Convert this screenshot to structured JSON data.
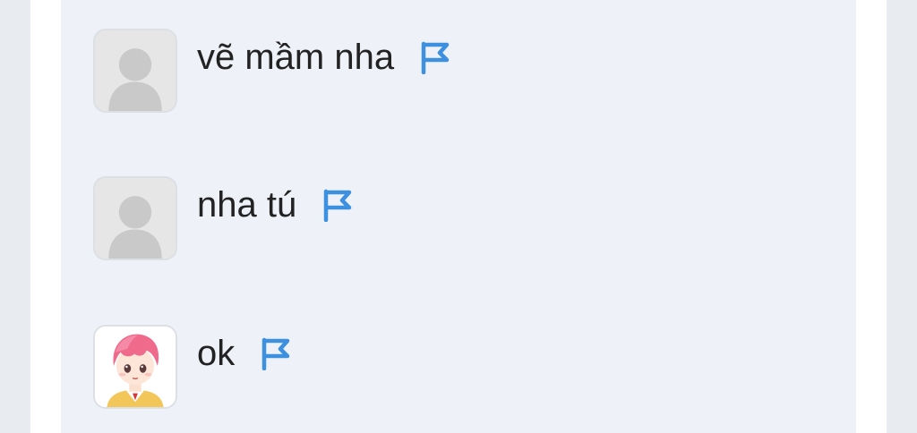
{
  "comments": [
    {
      "text": "vẽ mầm nha",
      "avatar": "default-avatar-icon",
      "action_icon": "flag-icon"
    },
    {
      "text": "nha tú",
      "avatar": "default-avatar-icon",
      "action_icon": "flag-icon"
    },
    {
      "text": "ok",
      "avatar": "anime-character-avatar",
      "action_icon": "flag-icon"
    }
  ],
  "colors": {
    "panel_background": "#eef2f8",
    "page_background": "#ffffff",
    "outer_background": "#e8ecf1",
    "text": "#222222",
    "flag": "#3d8fe0",
    "avatar_placeholder": "#c9c9c9"
  }
}
